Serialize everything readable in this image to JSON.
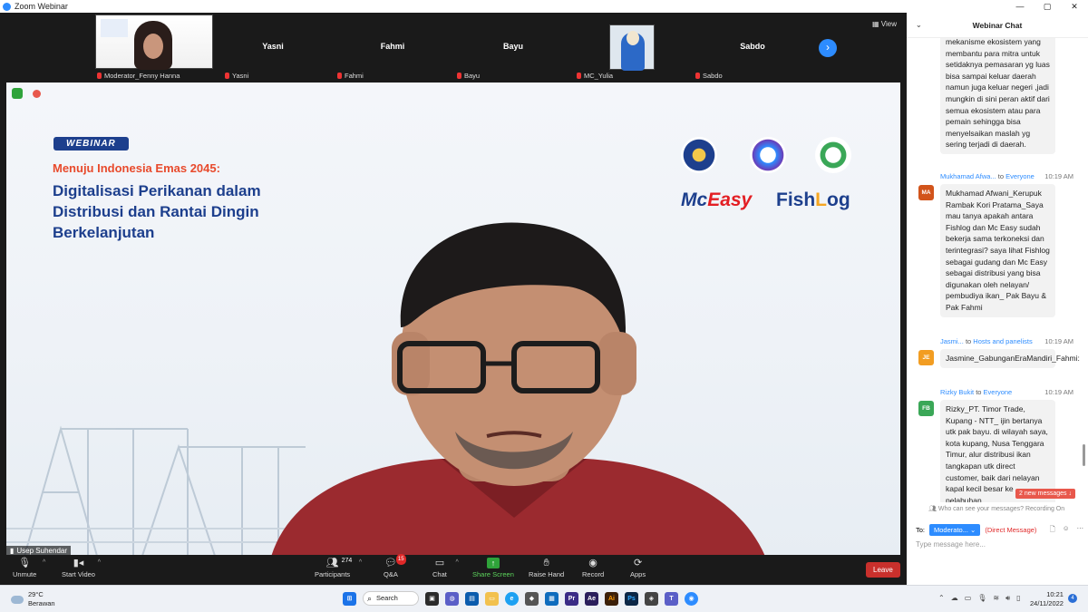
{
  "window": {
    "title": "Zoom Webinar",
    "controls": [
      "—",
      "▢",
      "✕"
    ]
  },
  "thumbnails": [
    {
      "name": "",
      "label": "Moderator_Fenny Hanna"
    },
    {
      "name": "Yasni",
      "label": "Yasni"
    },
    {
      "name": "Fahmi",
      "label": "Fahmi"
    },
    {
      "name": "Bayu",
      "label": "Bayu"
    },
    {
      "name": "",
      "label": "MC_Yulia"
    },
    {
      "name": "Sabdo",
      "label": "Sabdo"
    }
  ],
  "view_label": "View",
  "slide": {
    "badge": "WEBINAR",
    "subtitle": "Menuju Indonesia Emas 2045:",
    "headline": "Digitalisasi Perikanan dalam Distribusi dan Rantai Dingin Berkelanjutan",
    "logo_mceasy_a": "Mc",
    "logo_mceasy_b": "Easy",
    "logo_fishlog_a": "Fish",
    "logo_fishlog_b": "L",
    "logo_fishlog_c": "og"
  },
  "speaker_name": "Usep Suhendar",
  "toolbar": {
    "unmute": "Unmute",
    "start_video": "Start Video",
    "participants": "Participants",
    "participants_count": "274",
    "qa": "Q&A",
    "qa_badge": "15",
    "chat": "Chat",
    "share": "Share Screen",
    "raise": "Raise Hand",
    "record": "Record",
    "apps": "Apps",
    "leave": "Leave"
  },
  "chat": {
    "title": "Webinar Chat",
    "messages": [
      {
        "sender": "",
        "to": "",
        "time": "",
        "initials": "",
        "color": "#f2f2f2",
        "text": "mekanisme ekosistem yang membantu para mitra untuk setidaknya pemasaran yg luas bisa sampai keluar daerah namun juga keluar negeri ,jadi mungkin di sini peran aktif dari semua ekosistem atau para pemain sehingga bisa menyelsaikan maslah yg sering terjadi di daerah."
      },
      {
        "sender": "Mukhamad Afwa...",
        "to": "Everyone",
        "time": "10:19 AM",
        "initials": "MA",
        "color": "#d2541b",
        "text": "Mukhamad Afwani_Kerupuk Rambak Kori Pratama_Saya mau tanya apakah antara Fishlog dan Mc Easy sudah bekerja sama terkoneksi dan terintegrasi? saya lihat Fishlog  sebagai gudang dan Mc Easy sebagai distribusi yang bisa digunakan oleh nelayan/ pembudiya ikan_ Pak Bayu & Pak Fahmi"
      },
      {
        "sender": "Jasmi...",
        "to": "Hosts and panelists",
        "time": "10:19 AM",
        "initials": "JE",
        "color": "#f29d22",
        "text": "Jasmine_GabunganEraMandiri_Fahmi:"
      },
      {
        "sender": "Rizky Bukit",
        "to": "Everyone",
        "time": "10:19 AM",
        "initials": "FB",
        "color": "#3aa757",
        "text": "Rizky_PT. Timor Trade, Kupang - NTT_ ijin bertanya utk pak bayu. di wilayah saya, kota kupang, Nusa Tenggara Timur, alur distribusi ikan tangkapan utk direct customer, baik dari nelayan kapal kecil besar ke pelabuhan"
      }
    ],
    "to_word": "to",
    "new_messages": "2 new messages ↓",
    "who_can_see": "Who can see your messages? Recording On",
    "to_label": "To:",
    "to_select": "Moderato...",
    "direct_message": "(Direct Message)",
    "input_placeholder": "Type message here..."
  },
  "taskbar": {
    "temp": "29°C",
    "weather": "Berawan",
    "search": "Search",
    "time": "10:21",
    "date": "24/11/2022",
    "notif_count": "4"
  }
}
